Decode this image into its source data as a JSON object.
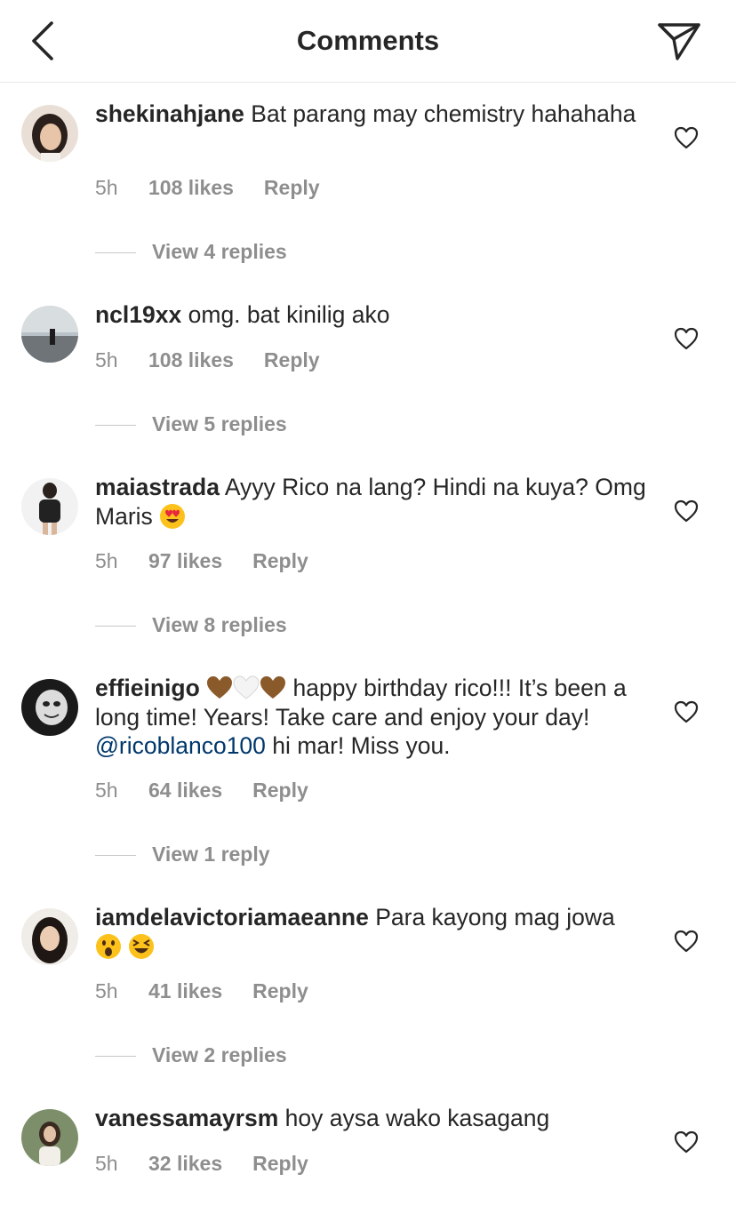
{
  "header": {
    "title": "Comments"
  },
  "comments": [
    {
      "username": "shekinahjane",
      "text": "Bat parang may chemistry hahahaha",
      "time": "5h",
      "likes": "108 likes",
      "reply": "Reply",
      "view_replies": "View 4 replies"
    },
    {
      "username": "ncl19xx",
      "text": "omg. bat kinilig ako",
      "time": "5h",
      "likes": "108 likes",
      "reply": "Reply",
      "view_replies": "View 5 replies"
    },
    {
      "username": "maiastrada",
      "text": "Ayyy Rico na lang? Hindi na kuya? Omg Maris",
      "emoji": "heart-eyes-emoji",
      "time": "5h",
      "likes": "97 likes",
      "reply": "Reply",
      "view_replies": "View 8 replies"
    },
    {
      "username": "effieinigo",
      "text_before": "happy birthday rico!!! It’s been a long time! Years! Take care and enjoy your day!",
      "mention": "@ricoblanco100",
      "text_after": "hi mar! Miss you.",
      "emojis": [
        "brown-heart-emoji",
        "white-heart-emoji",
        "brown-heart-emoji"
      ],
      "time": "5h",
      "likes": "64 likes",
      "reply": "Reply",
      "view_replies": "View 1 reply"
    },
    {
      "username": "iamdelavictoriamaeanne",
      "text": "Para kayong mag jowa",
      "emojis": [
        "astonished-face-emoji",
        "laughing-squint-emoji"
      ],
      "time": "5h",
      "likes": "41 likes",
      "reply": "Reply",
      "view_replies": "View 2 replies"
    },
    {
      "username": "vanessamayrsm",
      "text": "hoy aysa wako kasagang",
      "time": "5h",
      "likes": "32 likes",
      "reply": "Reply"
    }
  ],
  "icons": {
    "back": "chevron-left-icon",
    "send": "paper-plane-icon",
    "like": "heart-outline-icon"
  },
  "colors": {
    "text": "#262626",
    "muted": "#8e8e8e",
    "mention": "#00376b",
    "divider": "#e6e6e6"
  }
}
